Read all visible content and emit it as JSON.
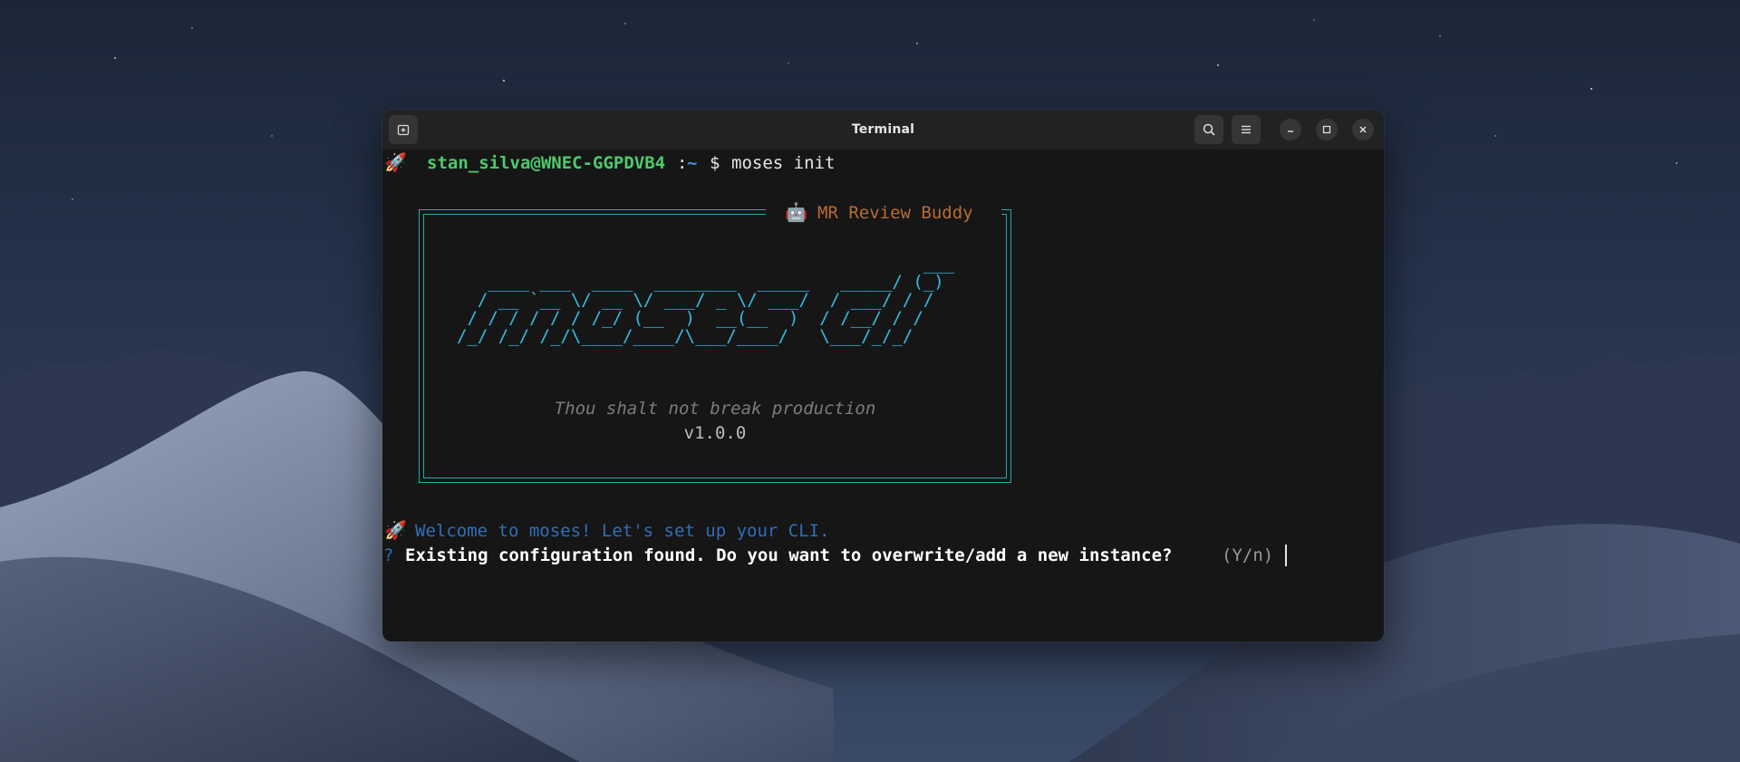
{
  "window": {
    "title": "Terminal"
  },
  "prompt": {
    "rocket": "🚀",
    "user_host": "stan_silva@WNEC-GGPDVB4",
    "separator": ":",
    "path": "~",
    "symbol": "$",
    "command": "moses init"
  },
  "banner": {
    "icon": "🤖",
    "title": "MR Review Buddy",
    "ascii_logo": "                                             ___\n   ____ ___  ____  ________  _____   _____/ (_)\n  / __ `__ \\/ __ \\/ ___/ _ \\/ ___/  / ___/ / /\n / / / / / / /_/ (__  )  __(__  )  / /__/ / /\n/_/ /_/ /_/\\____/____/\\___/____/   \\___/_/_/",
    "tagline": "Thou shalt not break production",
    "version": "v1.0.0"
  },
  "output": {
    "welcome_icon": "🚀",
    "welcome_text": "Welcome to moses! Let's set up your CLI.",
    "question_marker": "?",
    "question_text": "Existing configuration found. Do you want to overwrite/add a new instance?",
    "question_hint": "(Y/n)"
  },
  "colors": {
    "user_host": "#4ec96a",
    "path": "#4a90e2",
    "banner_border": "#2aa4ae",
    "banner_title": "#b76b35",
    "ascii_logo": "#33bde0",
    "welcome": "#2e6fb8",
    "terminal_bg": "#161616",
    "titlebar_bg": "#222222"
  },
  "icons": {
    "new_tab": "new-tab-icon",
    "search": "search-icon",
    "menu": "hamburger-menu-icon",
    "minimize": "minimize-icon",
    "maximize": "maximize-icon",
    "close": "close-icon"
  }
}
